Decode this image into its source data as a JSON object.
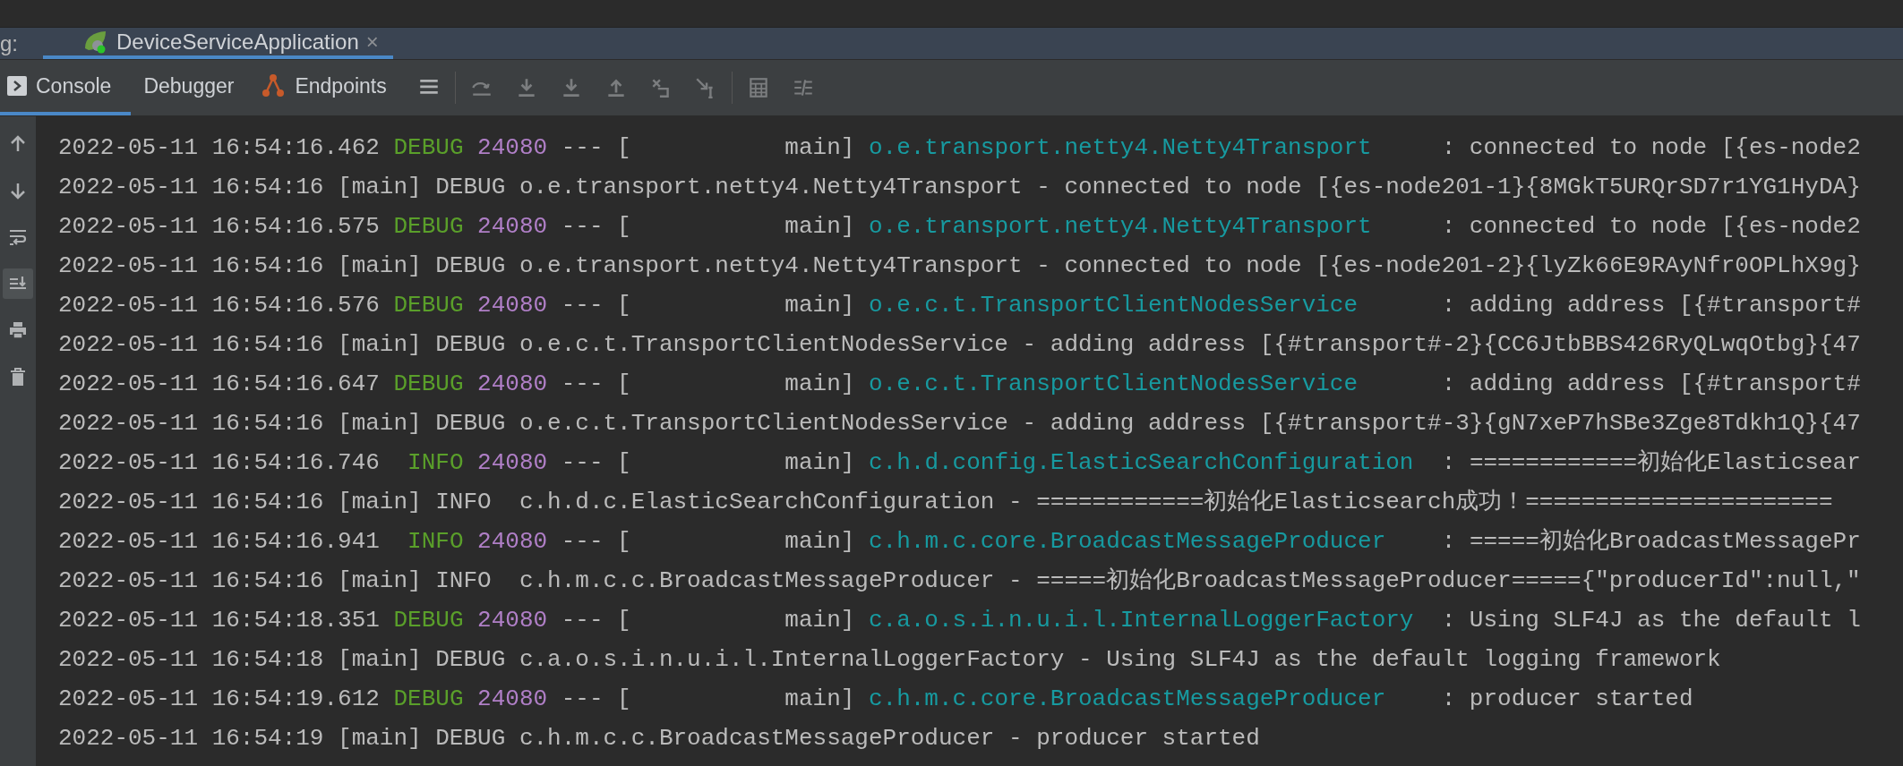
{
  "run_tabs": {
    "label": "g:",
    "tabs": [
      {
        "title": "DeviceServiceApplication",
        "close": "×",
        "selected": true
      }
    ]
  },
  "tool_tabs": [
    {
      "kind": "console",
      "label": "Console",
      "selected": true
    },
    {
      "kind": "plain",
      "label": "Debugger",
      "selected": false
    },
    {
      "kind": "endpoints",
      "label": "Endpoints",
      "selected": false
    }
  ],
  "debug_actions": [
    {
      "kind": "menu",
      "disabled": false
    },
    {
      "kind": "step-over",
      "disabled": true
    },
    {
      "kind": "step-into",
      "disabled": true
    },
    {
      "kind": "force-step-into",
      "disabled": true
    },
    {
      "kind": "step-out",
      "disabled": true
    },
    {
      "kind": "drop-frame",
      "disabled": true
    },
    {
      "kind": "run-to-cursor",
      "disabled": true
    },
    {
      "kind": "evaluate",
      "disabled": true
    },
    {
      "kind": "trace",
      "disabled": true
    }
  ],
  "side_toolbar": [
    {
      "kind": "up",
      "on": false
    },
    {
      "kind": "down",
      "on": false
    },
    {
      "kind": "wrap",
      "on": false
    },
    {
      "kind": "scroll-end",
      "on": true
    },
    {
      "kind": "print",
      "on": false
    },
    {
      "kind": "trash",
      "on": false
    }
  ],
  "console_lines": [
    [
      {
        "kind": "text",
        "text": "2022-05-11 16:54:16.462 "
      },
      {
        "kind": "level",
        "text": "DEBUG"
      },
      {
        "kind": "pid",
        "text": "24080"
      },
      {
        "kind": "text",
        "text": " --- [           main] "
      },
      {
        "kind": "logger",
        "text": "o.e.transport.netty4.Netty4Transport"
      },
      {
        "kind": "text",
        "text": "     : connected to node [{es-node2"
      }
    ],
    [
      {
        "kind": "text",
        "text": "2022-05-11 16:54:16 [main] DEBUG o.e.transport.netty4.Netty4Transport - connected to node [{es-node201-1}{8MGkT5URQrSD7r1YG1HyDA}"
      }
    ],
    [
      {
        "kind": "text",
        "text": "2022-05-11 16:54:16.575 "
      },
      {
        "kind": "level",
        "text": "DEBUG"
      },
      {
        "kind": "pid",
        "text": "24080"
      },
      {
        "kind": "text",
        "text": " --- [           main] "
      },
      {
        "kind": "logger",
        "text": "o.e.transport.netty4.Netty4Transport"
      },
      {
        "kind": "text",
        "text": "     : connected to node [{es-node2"
      }
    ],
    [
      {
        "kind": "text",
        "text": "2022-05-11 16:54:16 [main] DEBUG o.e.transport.netty4.Netty4Transport - connected to node [{es-node201-2}{lyZk66E9RAyNfr0OPLhX9g}"
      }
    ],
    [
      {
        "kind": "text",
        "text": "2022-05-11 16:54:16.576 "
      },
      {
        "kind": "level",
        "text": "DEBUG"
      },
      {
        "kind": "pid",
        "text": "24080"
      },
      {
        "kind": "text",
        "text": " --- [           main] "
      },
      {
        "kind": "logger",
        "text": "o.e.c.t.TransportClientNodesService"
      },
      {
        "kind": "text",
        "text": "      : adding address [{#transport#"
      }
    ],
    [
      {
        "kind": "text",
        "text": "2022-05-11 16:54:16 [main] DEBUG o.e.c.t.TransportClientNodesService - adding address [{#transport#-2}{CC6JtbBBS426RyQLwqOtbg}{47"
      }
    ],
    [
      {
        "kind": "text",
        "text": "2022-05-11 16:54:16.647 "
      },
      {
        "kind": "level",
        "text": "DEBUG"
      },
      {
        "kind": "pid",
        "text": "24080"
      },
      {
        "kind": "text",
        "text": " --- [           main] "
      },
      {
        "kind": "logger",
        "text": "o.e.c.t.TransportClientNodesService"
      },
      {
        "kind": "text",
        "text": "      : adding address [{#transport#"
      }
    ],
    [
      {
        "kind": "text",
        "text": "2022-05-11 16:54:16 [main] DEBUG o.e.c.t.TransportClientNodesService - adding address [{#transport#-3}{gN7xeP7hSBe3Zge8Tdkh1Q}{47"
      }
    ],
    [
      {
        "kind": "text",
        "text": "2022-05-11 16:54:16.746  "
      },
      {
        "kind": "level",
        "text": "INFO"
      },
      {
        "kind": "pid",
        "text": "24080"
      },
      {
        "kind": "text",
        "text": " --- [           main] "
      },
      {
        "kind": "logger",
        "text": "c.h.d.config.ElasticSearchConfiguration"
      },
      {
        "kind": "text",
        "text": "  : ============初始化Elasticsear"
      }
    ],
    [
      {
        "kind": "text",
        "text": "2022-05-11 16:54:16 [main] INFO  c.h.d.c.ElasticSearchConfiguration - ============初始化Elasticsearch成功！======================"
      }
    ],
    [
      {
        "kind": "text",
        "text": "2022-05-11 16:54:16.941  "
      },
      {
        "kind": "level",
        "text": "INFO"
      },
      {
        "kind": "pid",
        "text": "24080"
      },
      {
        "kind": "text",
        "text": " --- [           main] "
      },
      {
        "kind": "logger",
        "text": "c.h.m.c.core.BroadcastMessageProducer"
      },
      {
        "kind": "text",
        "text": "    : =====初始化BroadcastMessagePr"
      }
    ],
    [
      {
        "kind": "text",
        "text": "2022-05-11 16:54:16 [main] INFO  c.h.m.c.c.BroadcastMessageProducer - =====初始化BroadcastMessageProducer====={\"producerId\":null,\""
      }
    ],
    [
      {
        "kind": "text",
        "text": "2022-05-11 16:54:18.351 "
      },
      {
        "kind": "level",
        "text": "DEBUG"
      },
      {
        "kind": "pid",
        "text": "24080"
      },
      {
        "kind": "text",
        "text": " --- [           main] "
      },
      {
        "kind": "logger",
        "text": "c.a.o.s.i.n.u.i.l.InternalLoggerFactory"
      },
      {
        "kind": "text",
        "text": "  : Using SLF4J as the default l"
      }
    ],
    [
      {
        "kind": "text",
        "text": "2022-05-11 16:54:18 [main] DEBUG c.a.o.s.i.n.u.i.l.InternalLoggerFactory - Using SLF4J as the default logging framework"
      }
    ],
    [
      {
        "kind": "text",
        "text": "2022-05-11 16:54:19.612 "
      },
      {
        "kind": "level",
        "text": "DEBUG"
      },
      {
        "kind": "pid",
        "text": "24080"
      },
      {
        "kind": "text",
        "text": " --- [           main] "
      },
      {
        "kind": "logger",
        "text": "c.h.m.c.core.BroadcastMessageProducer"
      },
      {
        "kind": "text",
        "text": "    : producer started"
      }
    ],
    [
      {
        "kind": "text",
        "text": "2022-05-11 16:54:19 [main] DEBUG c.h.m.c.c.BroadcastMessageProducer - producer started"
      }
    ]
  ]
}
